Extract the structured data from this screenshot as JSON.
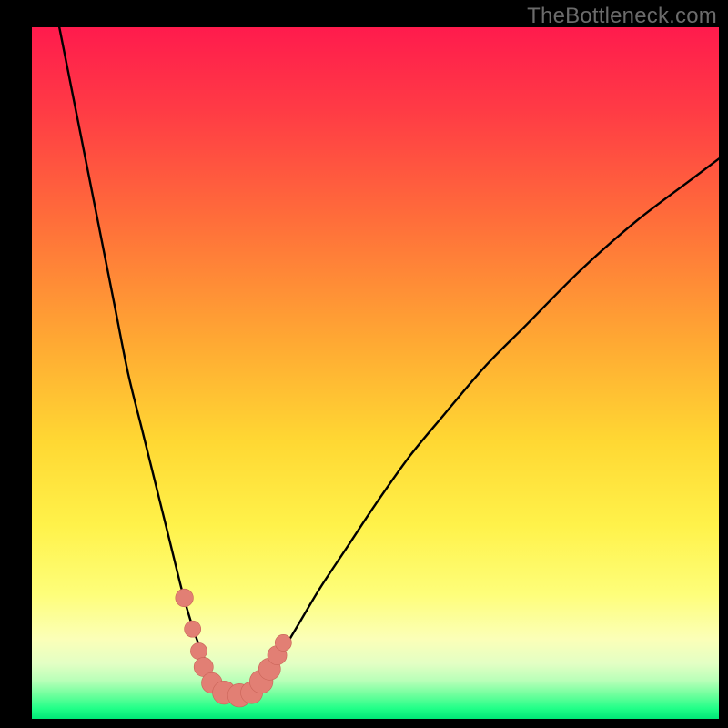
{
  "watermark": {
    "text": "TheBottleneck.com"
  },
  "colors": {
    "bg": "#000000",
    "curve": "#000000",
    "marker_fill": "#e27f74",
    "marker_stroke": "#c96357",
    "gradient_stops": [
      {
        "offset": 0.0,
        "color": "#ff1b4d"
      },
      {
        "offset": 0.12,
        "color": "#ff3b45"
      },
      {
        "offset": 0.28,
        "color": "#ff6e3a"
      },
      {
        "offset": 0.45,
        "color": "#ffa733"
      },
      {
        "offset": 0.6,
        "color": "#ffd833"
      },
      {
        "offset": 0.72,
        "color": "#fff24a"
      },
      {
        "offset": 0.82,
        "color": "#fefe7a"
      },
      {
        "offset": 0.885,
        "color": "#fbffb8"
      },
      {
        "offset": 0.92,
        "color": "#e3ffc4"
      },
      {
        "offset": 0.945,
        "color": "#b8ffb8"
      },
      {
        "offset": 0.965,
        "color": "#6fff9d"
      },
      {
        "offset": 0.985,
        "color": "#21ff88"
      },
      {
        "offset": 1.0,
        "color": "#00e877"
      }
    ]
  },
  "chart_data": {
    "type": "line",
    "title": "",
    "xlabel": "",
    "ylabel": "",
    "xlim": [
      0,
      100
    ],
    "ylim": [
      0,
      100
    ],
    "series": [
      {
        "name": "bottleneck-curve",
        "x": [
          4,
          6,
          8,
          10,
          12,
          14,
          16,
          18,
          20,
          22,
          23.5,
          25,
          26.5,
          28,
          29.5,
          31,
          32.5,
          34,
          36,
          39,
          42,
          46,
          50,
          55,
          60,
          66,
          72,
          80,
          88,
          96,
          100
        ],
        "y": [
          100,
          90,
          80,
          70,
          60,
          50,
          42,
          34,
          26,
          18,
          13,
          9,
          6,
          4,
          3,
          3,
          4,
          6,
          9,
          14,
          19,
          25,
          31,
          38,
          44,
          51,
          57,
          65,
          72,
          78,
          81
        ]
      }
    ],
    "markers": [
      {
        "x": 22.2,
        "y": 17.5,
        "r": 1.3
      },
      {
        "x": 23.4,
        "y": 13.0,
        "r": 1.2
      },
      {
        "x": 24.3,
        "y": 9.8,
        "r": 1.2
      },
      {
        "x": 25.0,
        "y": 7.5,
        "r": 1.4
      },
      {
        "x": 26.2,
        "y": 5.2,
        "r": 1.5
      },
      {
        "x": 28.0,
        "y": 3.8,
        "r": 1.7
      },
      {
        "x": 30.2,
        "y": 3.4,
        "r": 1.7
      },
      {
        "x": 32.0,
        "y": 3.8,
        "r": 1.6
      },
      {
        "x": 33.4,
        "y": 5.4,
        "r": 1.7
      },
      {
        "x": 34.6,
        "y": 7.2,
        "r": 1.6
      },
      {
        "x": 35.7,
        "y": 9.2,
        "r": 1.4
      },
      {
        "x": 36.6,
        "y": 11.0,
        "r": 1.2
      }
    ]
  }
}
